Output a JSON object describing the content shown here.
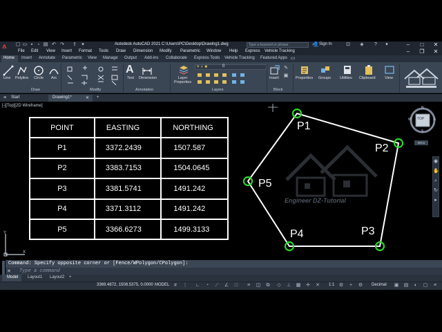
{
  "app": {
    "logo_letter": "A",
    "title": "Autodesk AutoCAD 2021   C:\\Users\\PC\\Desktop\\Drawing1.dwg",
    "search_placeholder": "Type a keyword or phrase",
    "sign_in": "Sign In"
  },
  "menu": [
    "File",
    "Edit",
    "View",
    "Insert",
    "Format",
    "Tools",
    "Draw",
    "Dimension",
    "Modify",
    "Parametric",
    "Window",
    "Help",
    "Express",
    "Vehicle Tracking"
  ],
  "ribbon_tabs": [
    "Home",
    "Insert",
    "Annotate",
    "Parametric",
    "View",
    "Manage",
    "Output",
    "Add-ins",
    "Collaborate",
    "Express Tools",
    "Vehicle Tracking",
    "Featured Apps"
  ],
  "ribbon": {
    "draw_tools": [
      "Line",
      "Polyline",
      "Circle",
      "Arc"
    ],
    "panels": {
      "draw": "Draw",
      "modify": "Modify",
      "annotation": "Annotation",
      "layers": "Layers",
      "block": "Block"
    },
    "annotation_tools": [
      "Text",
      "Dimension"
    ],
    "layer_properties": "Layer\nProperties",
    "layer_value": "0",
    "insert": "Insert",
    "right_tools": [
      "Properties",
      "Groups",
      "Utilities",
      "Clipboard",
      "View"
    ]
  },
  "doc_tabs": [
    "Start",
    "Drawing1*"
  ],
  "viewport_label": "[-][Top][2D Wireframe]",
  "table": {
    "headers": [
      "POINT",
      "EASTING",
      "NORTHING"
    ],
    "rows": [
      [
        "P1",
        "3372.2439",
        "1507.587"
      ],
      [
        "P2",
        "3383.7153",
        "1504.0645"
      ],
      [
        "P3",
        "3381.5741",
        "1491.242"
      ],
      [
        "P4",
        "3371.3112",
        "1491.242"
      ],
      [
        "P5",
        "3366.6273",
        "1499.3133"
      ]
    ]
  },
  "polygon_labels": [
    "P1",
    "P2",
    "P3",
    "P4",
    "P5"
  ],
  "viewcube": {
    "top": "TOP",
    "n": "N",
    "s": "S",
    "e": "E",
    "w": "W",
    "wcs": "WCS"
  },
  "watermark": {
    "line1": "Engineer DZ-Tutorial"
  },
  "command": {
    "history": "Command: Specify opposite corner or [Fence/WPolygon/CPolygon]:",
    "placeholder": "Type a command"
  },
  "layout_tabs": [
    "Model",
    "Layout1",
    "Layout2"
  ],
  "status": {
    "coords": "3369.4872, 1508.5375, 0.0000",
    "model": "MODEL",
    "scale": "1:1",
    "units": "Decimal"
  },
  "colors": {
    "accent_green": "#2bd62b",
    "polygon_stroke": "#ffffff",
    "ribbon_bg": "#3b4654"
  }
}
